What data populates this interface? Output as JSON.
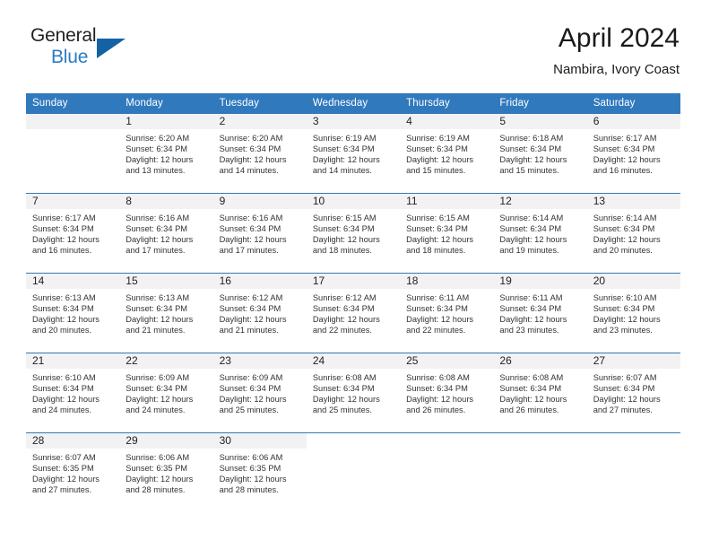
{
  "brand": {
    "word_one": "General",
    "word_two": "Blue",
    "logo_icon": "triangle-logo-icon"
  },
  "header": {
    "title": "April 2024",
    "subtitle": "Nambira, Ivory Coast"
  },
  "theme": {
    "header_blue": "#3079bd",
    "brand_dark": "#231f20",
    "brand_blue": "#2b7cc0",
    "daynum_band": "#f2f2f2",
    "body_text": "#333333"
  },
  "weekday_headers": [
    "Sunday",
    "Monday",
    "Tuesday",
    "Wednesday",
    "Thursday",
    "Friday",
    "Saturday"
  ],
  "weeks": [
    [
      {
        "day": "",
        "lines": []
      },
      {
        "day": "1",
        "lines": [
          "Sunrise: 6:20 AM",
          "Sunset: 6:34 PM",
          "Daylight: 12 hours",
          "and 13 minutes."
        ]
      },
      {
        "day": "2",
        "lines": [
          "Sunrise: 6:20 AM",
          "Sunset: 6:34 PM",
          "Daylight: 12 hours",
          "and 14 minutes."
        ]
      },
      {
        "day": "3",
        "lines": [
          "Sunrise: 6:19 AM",
          "Sunset: 6:34 PM",
          "Daylight: 12 hours",
          "and 14 minutes."
        ]
      },
      {
        "day": "4",
        "lines": [
          "Sunrise: 6:19 AM",
          "Sunset: 6:34 PM",
          "Daylight: 12 hours",
          "and 15 minutes."
        ]
      },
      {
        "day": "5",
        "lines": [
          "Sunrise: 6:18 AM",
          "Sunset: 6:34 PM",
          "Daylight: 12 hours",
          "and 15 minutes."
        ]
      },
      {
        "day": "6",
        "lines": [
          "Sunrise: 6:17 AM",
          "Sunset: 6:34 PM",
          "Daylight: 12 hours",
          "and 16 minutes."
        ]
      }
    ],
    [
      {
        "day": "7",
        "lines": [
          "Sunrise: 6:17 AM",
          "Sunset: 6:34 PM",
          "Daylight: 12 hours",
          "and 16 minutes."
        ]
      },
      {
        "day": "8",
        "lines": [
          "Sunrise: 6:16 AM",
          "Sunset: 6:34 PM",
          "Daylight: 12 hours",
          "and 17 minutes."
        ]
      },
      {
        "day": "9",
        "lines": [
          "Sunrise: 6:16 AM",
          "Sunset: 6:34 PM",
          "Daylight: 12 hours",
          "and 17 minutes."
        ]
      },
      {
        "day": "10",
        "lines": [
          "Sunrise: 6:15 AM",
          "Sunset: 6:34 PM",
          "Daylight: 12 hours",
          "and 18 minutes."
        ]
      },
      {
        "day": "11",
        "lines": [
          "Sunrise: 6:15 AM",
          "Sunset: 6:34 PM",
          "Daylight: 12 hours",
          "and 18 minutes."
        ]
      },
      {
        "day": "12",
        "lines": [
          "Sunrise: 6:14 AM",
          "Sunset: 6:34 PM",
          "Daylight: 12 hours",
          "and 19 minutes."
        ]
      },
      {
        "day": "13",
        "lines": [
          "Sunrise: 6:14 AM",
          "Sunset: 6:34 PM",
          "Daylight: 12 hours",
          "and 20 minutes."
        ]
      }
    ],
    [
      {
        "day": "14",
        "lines": [
          "Sunrise: 6:13 AM",
          "Sunset: 6:34 PM",
          "Daylight: 12 hours",
          "and 20 minutes."
        ]
      },
      {
        "day": "15",
        "lines": [
          "Sunrise: 6:13 AM",
          "Sunset: 6:34 PM",
          "Daylight: 12 hours",
          "and 21 minutes."
        ]
      },
      {
        "day": "16",
        "lines": [
          "Sunrise: 6:12 AM",
          "Sunset: 6:34 PM",
          "Daylight: 12 hours",
          "and 21 minutes."
        ]
      },
      {
        "day": "17",
        "lines": [
          "Sunrise: 6:12 AM",
          "Sunset: 6:34 PM",
          "Daylight: 12 hours",
          "and 22 minutes."
        ]
      },
      {
        "day": "18",
        "lines": [
          "Sunrise: 6:11 AM",
          "Sunset: 6:34 PM",
          "Daylight: 12 hours",
          "and 22 minutes."
        ]
      },
      {
        "day": "19",
        "lines": [
          "Sunrise: 6:11 AM",
          "Sunset: 6:34 PM",
          "Daylight: 12 hours",
          "and 23 minutes."
        ]
      },
      {
        "day": "20",
        "lines": [
          "Sunrise: 6:10 AM",
          "Sunset: 6:34 PM",
          "Daylight: 12 hours",
          "and 23 minutes."
        ]
      }
    ],
    [
      {
        "day": "21",
        "lines": [
          "Sunrise: 6:10 AM",
          "Sunset: 6:34 PM",
          "Daylight: 12 hours",
          "and 24 minutes."
        ]
      },
      {
        "day": "22",
        "lines": [
          "Sunrise: 6:09 AM",
          "Sunset: 6:34 PM",
          "Daylight: 12 hours",
          "and 24 minutes."
        ]
      },
      {
        "day": "23",
        "lines": [
          "Sunrise: 6:09 AM",
          "Sunset: 6:34 PM",
          "Daylight: 12 hours",
          "and 25 minutes."
        ]
      },
      {
        "day": "24",
        "lines": [
          "Sunrise: 6:08 AM",
          "Sunset: 6:34 PM",
          "Daylight: 12 hours",
          "and 25 minutes."
        ]
      },
      {
        "day": "25",
        "lines": [
          "Sunrise: 6:08 AM",
          "Sunset: 6:34 PM",
          "Daylight: 12 hours",
          "and 26 minutes."
        ]
      },
      {
        "day": "26",
        "lines": [
          "Sunrise: 6:08 AM",
          "Sunset: 6:34 PM",
          "Daylight: 12 hours",
          "and 26 minutes."
        ]
      },
      {
        "day": "27",
        "lines": [
          "Sunrise: 6:07 AM",
          "Sunset: 6:34 PM",
          "Daylight: 12 hours",
          "and 27 minutes."
        ]
      }
    ],
    [
      {
        "day": "28",
        "lines": [
          "Sunrise: 6:07 AM",
          "Sunset: 6:35 PM",
          "Daylight: 12 hours",
          "and 27 minutes."
        ]
      },
      {
        "day": "29",
        "lines": [
          "Sunrise: 6:06 AM",
          "Sunset: 6:35 PM",
          "Daylight: 12 hours",
          "and 28 minutes."
        ]
      },
      {
        "day": "30",
        "lines": [
          "Sunrise: 6:06 AM",
          "Sunset: 6:35 PM",
          "Daylight: 12 hours",
          "and 28 minutes."
        ]
      },
      {
        "day": "",
        "lines": []
      },
      {
        "day": "",
        "lines": []
      },
      {
        "day": "",
        "lines": []
      },
      {
        "day": "",
        "lines": []
      }
    ]
  ]
}
